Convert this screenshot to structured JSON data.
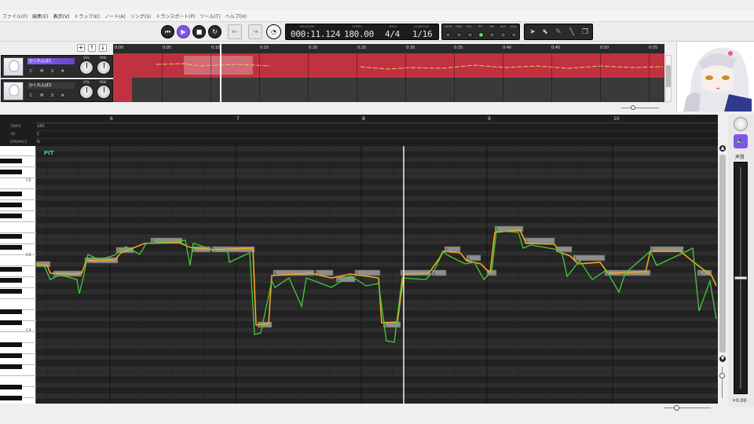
{
  "menu": [
    "ファイル(F)",
    "編集(E)",
    "表示(V)",
    "トラック(K)",
    "ノート(A)",
    "ソング(S)",
    "トランスポート(P)",
    "ツール(T)",
    "ヘルプ(H)"
  ],
  "transport": {
    "measure_caption": "MEASURE",
    "measure_value": "000:11.124",
    "tempo_caption": "TEMPO",
    "tempo_value": "180.00",
    "beat_caption": "BEAT",
    "beat_value": "4/4",
    "quantize_caption": "QUANTIZE",
    "quantize_value": "1/16"
  },
  "mode_labels": [
    "NOTE",
    "TIME",
    "VOL",
    "PIT",
    "VIB",
    "ALP",
    "ALN"
  ],
  "tracks": [
    {
      "name": "かくれんぼ1",
      "buttons": [
        "C",
        "M",
        "S",
        "❄"
      ]
    },
    {
      "name": "かくれんぼ2",
      "buttons": [
        "C",
        "M",
        "S",
        "❄"
      ]
    }
  ],
  "knob_labels": {
    "vol": "VOL",
    "pan": "PAN"
  },
  "timeline_ticks": [
    "0:00",
    "0:05",
    "0:10",
    "0:15",
    "0:20",
    "0:25",
    "0:30",
    "0:35",
    "0:40",
    "0:45",
    "0:50",
    "0:55"
  ],
  "param_rows": [
    "TEMPO",
    "VEI",
    "DYNAMICS"
  ],
  "param_values": [
    "180",
    "C",
    "N"
  ],
  "bar_numbers": [
    "6",
    "7",
    "8",
    "9",
    "10"
  ],
  "key_labels": [
    "C6",
    "C5",
    "C4"
  ],
  "pit_label": "PIT",
  "right_panel": {
    "label": "声質",
    "value": "+0.00"
  },
  "note_label_mark": "L",
  "colors": {
    "accent": "#7e55e6",
    "track_red": "#c0323f",
    "pitch_orange": "#f5a623",
    "pitch_green": "#47c93a"
  }
}
